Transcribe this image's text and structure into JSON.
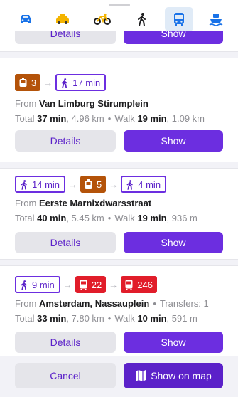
{
  "modes": [
    {
      "icon": "car-icon",
      "active": false
    },
    {
      "icon": "taxi-icon",
      "active": false
    },
    {
      "icon": "bicycle-icon",
      "active": false
    },
    {
      "icon": "walking-icon",
      "active": false
    },
    {
      "icon": "bus-icon",
      "active": true
    },
    {
      "icon": "ferry-icon",
      "active": false
    }
  ],
  "labels": {
    "details": "Details",
    "show": "Show",
    "from": "From",
    "total": "Total",
    "walk": "Walk",
    "cancel": "Cancel",
    "show_on_map": "Show on map"
  },
  "routes": [
    {
      "legs": [
        "tram 3",
        "walk 17 min"
      ],
      "leg1_value": "3",
      "leg2_value": "17 min",
      "from": "Van Limburg Stirumplein",
      "total_time": "37 min",
      "total_distance": ", 4.96 km",
      "walk_time": "19 min",
      "walk_distance": ", 1.09 km"
    },
    {
      "leg1_value": "14 min",
      "leg2_value": "5",
      "leg3_value": "4 min",
      "from": "Eerste Marnixdwarsstraat",
      "total_time": "40 min",
      "total_distance": ", 5.45 km",
      "walk_time": "19 min",
      "walk_distance": ", 936 m"
    },
    {
      "leg1_value": "9 min",
      "leg2_value": "22",
      "leg3_value": "246",
      "from": "Amsterdam, Nassauplein",
      "transfers": "Transfers: 1",
      "total_time": "33 min",
      "total_distance": ", 7.80 km",
      "walk_time": "10 min",
      "walk_distance": ", 591 m"
    }
  ],
  "colors": {
    "accent": "#6c2ee0",
    "tram": "#b45309",
    "bus": "#e11d2a",
    "mode_icon": "#f4b400",
    "bus_mode": "#1a73e8"
  }
}
